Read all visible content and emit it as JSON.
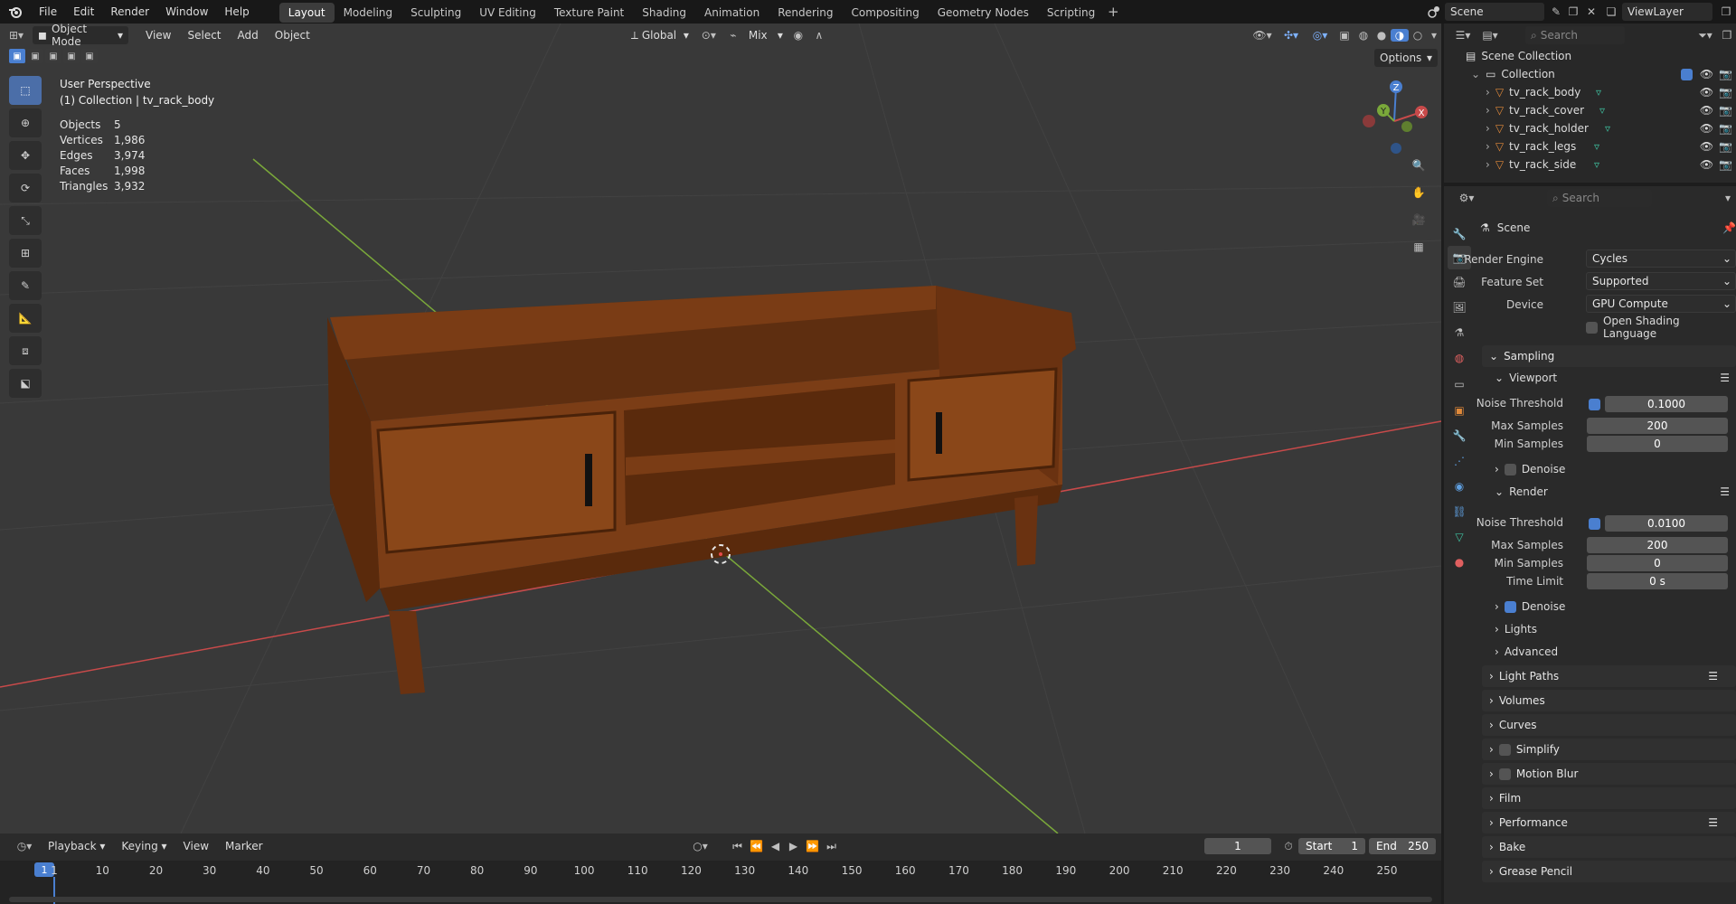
{
  "menu": [
    "File",
    "Edit",
    "Render",
    "Window",
    "Help"
  ],
  "workspaces": [
    {
      "label": "Layout",
      "active": true
    },
    {
      "label": "Modeling"
    },
    {
      "label": "Sculpting"
    },
    {
      "label": "UV Editing"
    },
    {
      "label": "Texture Paint"
    },
    {
      "label": "Shading"
    },
    {
      "label": "Animation"
    },
    {
      "label": "Rendering"
    },
    {
      "label": "Compositing"
    },
    {
      "label": "Geometry Nodes"
    },
    {
      "label": "Scripting"
    }
  ],
  "scene_name": "Scene",
  "view_layer": "ViewLayer",
  "viewport_header": {
    "mode": "Object Mode",
    "menus": [
      "View",
      "Select",
      "Add",
      "Object"
    ],
    "orientation": "Global",
    "snap": "Mix",
    "options": "Options"
  },
  "overlay": {
    "view_name": "User Perspective",
    "collection_line": "(1) Collection | tv_rack_body",
    "stats": [
      {
        "key": "Objects",
        "value": "5"
      },
      {
        "key": "Vertices",
        "value": "1,986"
      },
      {
        "key": "Edges",
        "value": "3,974"
      },
      {
        "key": "Faces",
        "value": "1,998"
      },
      {
        "key": "Triangles",
        "value": "3,932"
      }
    ]
  },
  "gizmo": {
    "z": "Z",
    "y": "Y",
    "x": "X"
  },
  "outliner": {
    "search": "Search",
    "root": "Scene Collection",
    "collection": "Collection",
    "objects": [
      "tv_rack_body",
      "tv_rack_cover",
      "tv_rack_holder",
      "tv_rack_legs",
      "tv_rack_side"
    ]
  },
  "properties": {
    "search": "Search",
    "context": "Scene",
    "render_engine_label": "Render Engine",
    "render_engine": "Cycles",
    "feature_set_label": "Feature Set",
    "feature_set": "Supported",
    "device_label": "Device",
    "device": "GPU Compute",
    "osl": "Open Shading Language",
    "sampling": "Sampling",
    "viewport": "Viewport",
    "vp_noise_label": "Noise Threshold",
    "vp_noise": "0.1000",
    "vp_max_label": "Max Samples",
    "vp_max": "200",
    "vp_min_label": "Min Samples",
    "vp_min": "0",
    "vp_denoise": "Denoise",
    "render": "Render",
    "r_noise_label": "Noise Threshold",
    "r_noise": "0.0100",
    "r_max_label": "Max Samples",
    "r_max": "200",
    "r_min_label": "Min Samples",
    "r_min": "0",
    "r_time_label": "Time Limit",
    "r_time": "0 s",
    "r_denoise": "Denoise",
    "lights": "Lights",
    "advanced": "Advanced",
    "panels": [
      "Light Paths",
      "Volumes",
      "Curves",
      "Simplify",
      "Motion Blur",
      "Film",
      "Performance",
      "Bake",
      "Grease Pencil"
    ]
  },
  "timeline": {
    "menus": [
      "Playback",
      "Keying",
      "View",
      "Marker"
    ],
    "current_frame": "1",
    "start_label": "Start",
    "start": "1",
    "end_label": "End",
    "end": "250",
    "ticks": [
      "1",
      "10",
      "20",
      "30",
      "40",
      "50",
      "60",
      "70",
      "80",
      "90",
      "100",
      "110",
      "120",
      "130",
      "140",
      "150",
      "160",
      "170",
      "180",
      "190",
      "200",
      "210",
      "220",
      "230",
      "240",
      "250"
    ]
  },
  "colors": {
    "accent": "#4a7fd0",
    "wood": "#7a3c15",
    "x_axis": "#c84a4a",
    "y_axis": "#7aa83a",
    "z_axis": "#4a7fd0"
  }
}
